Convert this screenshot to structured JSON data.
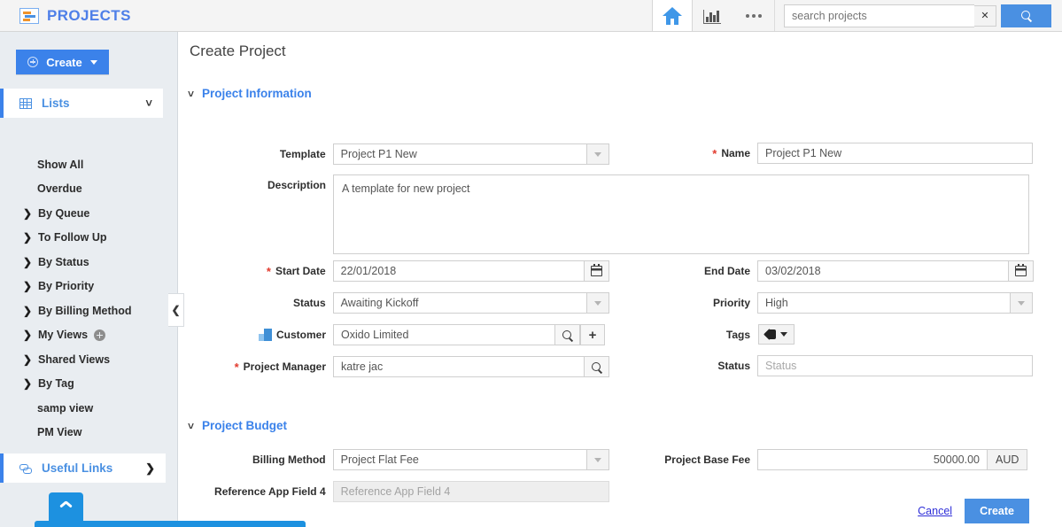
{
  "topbar": {
    "brand_title": "PROJECTS",
    "home_tooltip": "Home",
    "reports_tooltip": "Reports",
    "more_tooltip": "More",
    "search_placeholder": "search projects",
    "search_value": ""
  },
  "sidebar": {
    "create_label": "Create",
    "lists_label": "Lists",
    "items": [
      {
        "label": "Show All",
        "expandable": false
      },
      {
        "label": "Overdue",
        "expandable": false
      },
      {
        "label": "By Queue",
        "expandable": true
      },
      {
        "label": "To Follow Up",
        "expandable": true
      },
      {
        "label": "By Status",
        "expandable": true
      },
      {
        "label": "By Priority",
        "expandable": true
      },
      {
        "label": "By Billing Method",
        "expandable": true
      },
      {
        "label": "My Views",
        "expandable": true
      },
      {
        "label": "Shared Views",
        "expandable": true
      },
      {
        "label": "By Tag",
        "expandable": true
      },
      {
        "label": "samp view",
        "expandable": false
      },
      {
        "label": "PM View",
        "expandable": false
      }
    ],
    "useful_links_label": "Useful Links",
    "collapse_glyph": "❮",
    "expand_arrow": "❯",
    "chevron_down": "⌄",
    "chevron_right": "❯"
  },
  "main": {
    "page_title": "Create Project",
    "section_project_information": "Project Information",
    "section_project_budget": "Project Budget",
    "fields": {
      "template_label": "Template",
      "template_value": "Project P1 New",
      "name_label": "Name",
      "name_value": "Project P1 New",
      "description_label": "Description",
      "description_value": "A template for new project",
      "start_date_label": "Start Date",
      "start_date_value": "22/01/2018",
      "end_date_label": "End Date",
      "end_date_value": "03/02/2018",
      "status_label": "Status",
      "status_value": "Awaiting Kickoff",
      "priority_label": "Priority",
      "priority_value": "High",
      "customer_label": "Customer",
      "customer_value": "Oxido Limited",
      "tags_label": "Tags",
      "project_manager_label": "Project Manager",
      "project_manager_value": "katre jac",
      "status2_label": "Status",
      "status2_placeholder": "Status",
      "billing_method_label": "Billing Method",
      "billing_method_value": "Project Flat Fee",
      "project_base_fee_label": "Project Base Fee",
      "project_base_fee_value": "50000.00",
      "project_base_fee_currency": "AUD",
      "reference_app_field_4_label": "Reference App Field 4",
      "reference_app_field_4_placeholder": "Reference App Field 4"
    },
    "footer": {
      "cancel_label": "Cancel",
      "create_label": "Create"
    }
  },
  "colors": {
    "brand_blue": "#4e7fe8",
    "accent_blue": "#3b82ea",
    "button_blue": "#4a90e2",
    "required_red": "#e23b2e",
    "sidebar_bg": "#e9edf1",
    "topbar_bg": "#f4f4f4",
    "bottom_bar_blue": "#1d91e0"
  }
}
